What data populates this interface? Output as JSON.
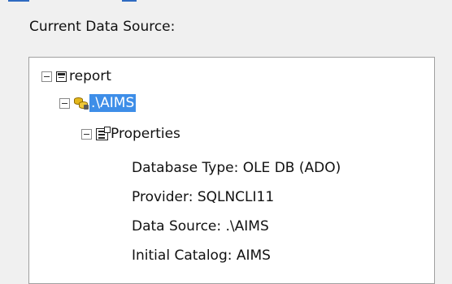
{
  "header": {
    "label": "Current Data Source:"
  },
  "tree": {
    "root": {
      "label": "report",
      "icon": "report-icon"
    },
    "datasource": {
      "label": ".\\AIMS",
      "icon": "database-icon",
      "selected": true
    },
    "properties": {
      "label": "Properties",
      "icon": "properties-icon"
    },
    "props": [
      "Database Type: OLE DB (ADO)",
      "Provider: SQLNCLI11",
      "Data Source: .\\AIMS",
      "Initial Catalog: AIMS"
    ]
  },
  "colors": {
    "selection": "#3e8ee8",
    "accent": "#2f6bc1"
  }
}
